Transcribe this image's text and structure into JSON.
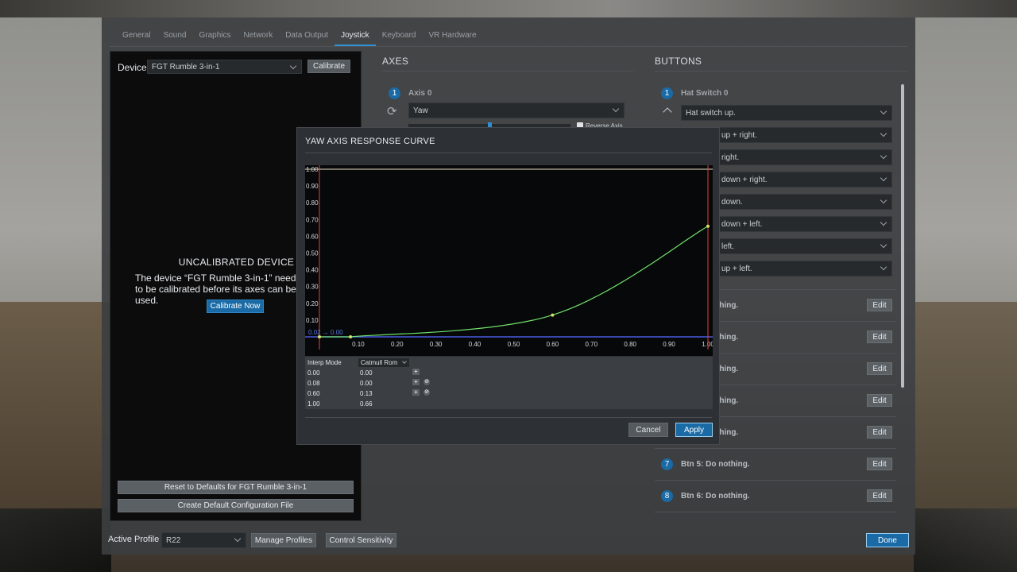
{
  "tabs": [
    {
      "label": "General"
    },
    {
      "label": "Sound"
    },
    {
      "label": "Graphics"
    },
    {
      "label": "Network"
    },
    {
      "label": "Data Output"
    },
    {
      "label": "Joystick"
    },
    {
      "label": "Keyboard"
    },
    {
      "label": "VR Hardware"
    }
  ],
  "active_tab": "Joystick",
  "device": {
    "label": "Device",
    "selected": "FGT Rumble 3-in-1",
    "calibrate_label": "Calibrate",
    "uncalibrated_title": "UNCALIBRATED DEVICE",
    "uncalibrated_message": "The device “FGT Rumble 3-in-1” needs to be calibrated before its axes can be used.",
    "calibrate_now_label": "Calibrate Now",
    "reset_label": "Reset to Defaults for FGT Rumble 3-in-1",
    "create_config_label": "Create Default Configuration File"
  },
  "axes": {
    "title": "AXES",
    "axis0": {
      "number": "1",
      "name": "Axis 0",
      "assignment": "Yaw",
      "reverse_label": "Reverse Axis"
    }
  },
  "buttons": {
    "title": "BUTTONS",
    "hat": {
      "number": "1",
      "name": "Hat Switch 0"
    },
    "hat_options": [
      "Hat switch up.",
      "up + right.",
      "right.",
      "down + right.",
      "down.",
      "down + left.",
      "left.",
      "up + left."
    ],
    "rows": [
      {
        "number": "",
        "text": "thing.",
        "edit": "Edit"
      },
      {
        "number": "",
        "text": "thing.",
        "edit": "Edit"
      },
      {
        "number": "",
        "text": "thing.",
        "edit": "Edit"
      },
      {
        "number": "",
        "text": "thing.",
        "edit": "Edit"
      },
      {
        "number": "",
        "text": "thing.",
        "edit": "Edit"
      },
      {
        "number": "7",
        "text": "Btn 5: Do nothing.",
        "edit": "Edit"
      },
      {
        "number": "8",
        "text": "Btn 6: Do nothing.",
        "edit": "Edit"
      }
    ]
  },
  "bottom": {
    "profile_label": "Active Profile",
    "profile_value": "R22",
    "manage_label": "Manage Profiles",
    "sensitivity_label": "Control Sensitivity",
    "done_label": "Done"
  },
  "dialog": {
    "title": "YAW AXIS RESPONSE CURVE",
    "readout": "0.02 → 0.00",
    "interp_label": "Interp Mode",
    "interp_value": "Catmull Rom",
    "points": [
      {
        "x": "0.00",
        "y": "0.00"
      },
      {
        "x": "0.08",
        "y": "0.00"
      },
      {
        "x": "0.60",
        "y": "0.13"
      },
      {
        "x": "1.00",
        "y": "0.66"
      }
    ],
    "cancel_label": "Cancel",
    "apply_label": "Apply"
  },
  "chart_data": {
    "type": "line",
    "x_ticks": [
      "0.10",
      "0.20",
      "0.30",
      "0.40",
      "0.50",
      "0.60",
      "0.70",
      "0.80",
      "0.90",
      "1.00"
    ],
    "y_ticks": [
      "0.10",
      "0.20",
      "0.30",
      "0.40",
      "0.50",
      "0.60",
      "0.70",
      "0.80",
      "0.90",
      "1.00"
    ],
    "xlim": [
      0,
      1
    ],
    "ylim": [
      0,
      1
    ],
    "control_points": [
      [
        0.0,
        0.0
      ],
      [
        0.08,
        0.0
      ],
      [
        0.6,
        0.13
      ],
      [
        1.0,
        0.66
      ]
    ],
    "colors": {
      "curve": "#6fe36a",
      "points": "#d8e06a",
      "bounds": "#e0443c",
      "baseline": "#4a5be0",
      "top": "#e8e2c8"
    }
  }
}
